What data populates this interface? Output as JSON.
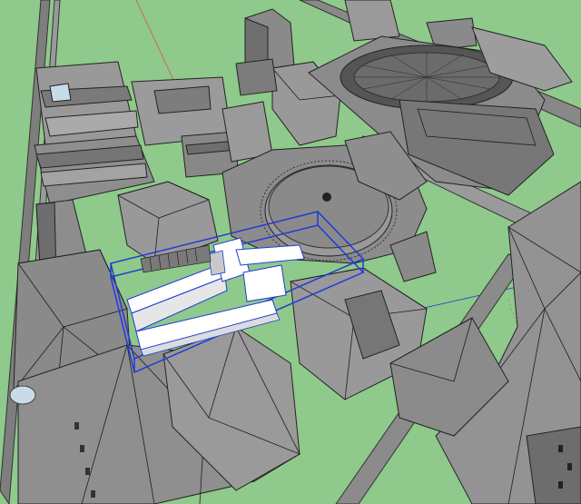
{
  "scene": {
    "ground_color": "#8fc98b",
    "building_color": "#8d8d8d",
    "building_light": "#a7a7a7",
    "building_dark": "#6c6c6c",
    "edge_color": "#222222",
    "selection_color": "#1f3bd6",
    "selected_model_color": "#ffffff",
    "axis_red": "#e05050",
    "axis_green": "#3a9b3a",
    "axis_blue": "#2a3fd0"
  }
}
